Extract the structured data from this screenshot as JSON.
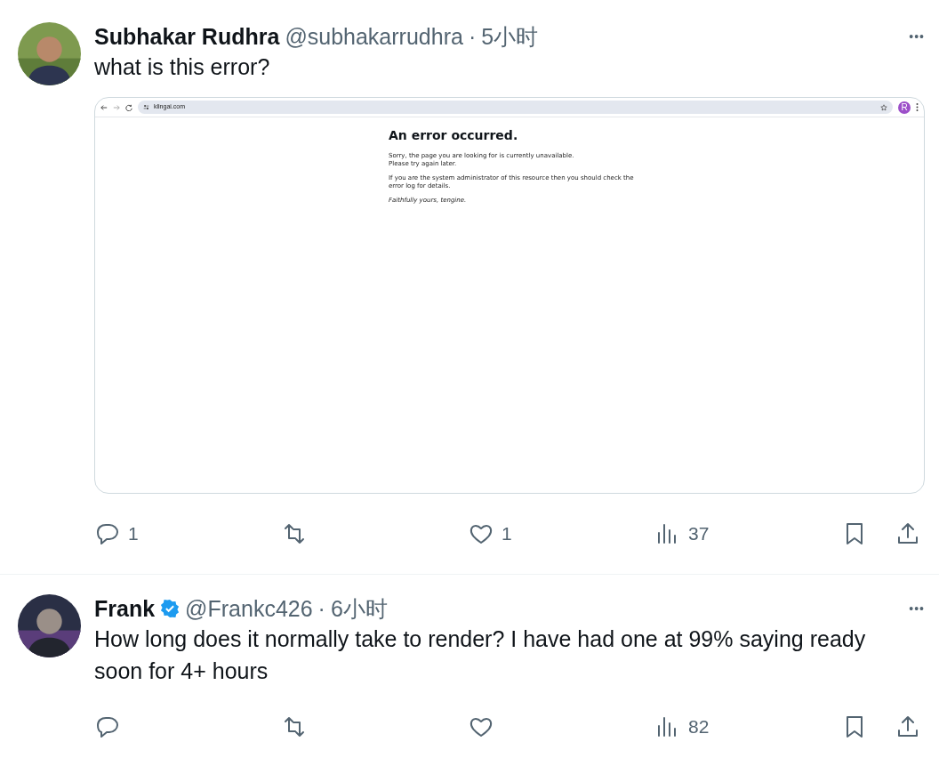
{
  "tweets": [
    {
      "author": "Subhakar Rudhra",
      "verified": false,
      "handle": "@subhakarrudhra",
      "separator": "·",
      "time": "5小时",
      "more": "•••",
      "text": "what is this error?",
      "attachment": {
        "kind": "browser_screenshot",
        "url": "klingai.com",
        "profile_initial": "R",
        "title": "An error occurred.",
        "paragraphs": [
          "Sorry, the page you are looking for is currently unavailable.\nPlease try again later.",
          "If you are the system administrator of this resource then you should check the\nerror log for details."
        ],
        "signature": "Faithfully yours, tengine."
      },
      "actions": [
        {
          "kind": "reply",
          "count": "1"
        },
        {
          "kind": "repost"
        },
        {
          "kind": "like",
          "count": "1"
        },
        {
          "kind": "views",
          "count": "37"
        },
        {
          "kind": "bookmark"
        },
        {
          "kind": "share"
        }
      ]
    },
    {
      "author": "Frank",
      "verified": true,
      "handle": "@Frankc426",
      "separator": "·",
      "time": "6小时",
      "more": "•••",
      "text": "How long does it normally take to render? I have had one at 99% saying ready soon for 4+ hours",
      "actions": [
        {
          "kind": "reply"
        },
        {
          "kind": "repost"
        },
        {
          "kind": "like"
        },
        {
          "kind": "views",
          "count": "82"
        },
        {
          "kind": "bookmark"
        },
        {
          "kind": "share"
        }
      ]
    }
  ]
}
